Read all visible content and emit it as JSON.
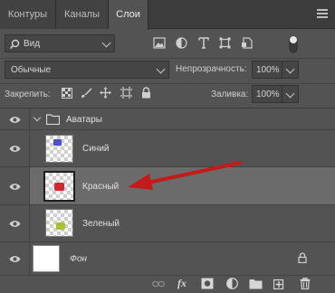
{
  "tabs": [
    {
      "label": "Контуры",
      "active": false
    },
    {
      "label": "Каналы",
      "active": false
    },
    {
      "label": "Слои",
      "active": true
    }
  ],
  "filter": {
    "kind_value": "Вид"
  },
  "blend": {
    "mode_value": "Обычные",
    "opacity_label": "Непрозрачность:",
    "opacity_value": "100%"
  },
  "lock": {
    "label": "Закрепить:",
    "fill_label": "Заливка:",
    "fill_value": "100%"
  },
  "layers": [
    {
      "name": "Аватары",
      "type": "group",
      "expanded": true,
      "visible": true
    },
    {
      "name": "Синий",
      "type": "layer",
      "visible": true,
      "content_color": "#4b54c9"
    },
    {
      "name": "Красный",
      "type": "layer",
      "visible": true,
      "selected": true,
      "content_color": "#d8262e"
    },
    {
      "name": "Зеленый",
      "type": "layer",
      "visible": true,
      "content_color": "#a7c12a"
    },
    {
      "name": "Фон",
      "type": "background",
      "visible": true,
      "locked": true
    }
  ],
  "colors": {
    "panel": "#535353",
    "selected_row": "#6b6b6b",
    "arrow": "#c41a1a"
  },
  "bottom_icons": [
    "link-icon",
    "fx-icon",
    "mask-icon",
    "adjustment-icon",
    "folder-icon",
    "new-layer-icon",
    "trash-icon"
  ]
}
